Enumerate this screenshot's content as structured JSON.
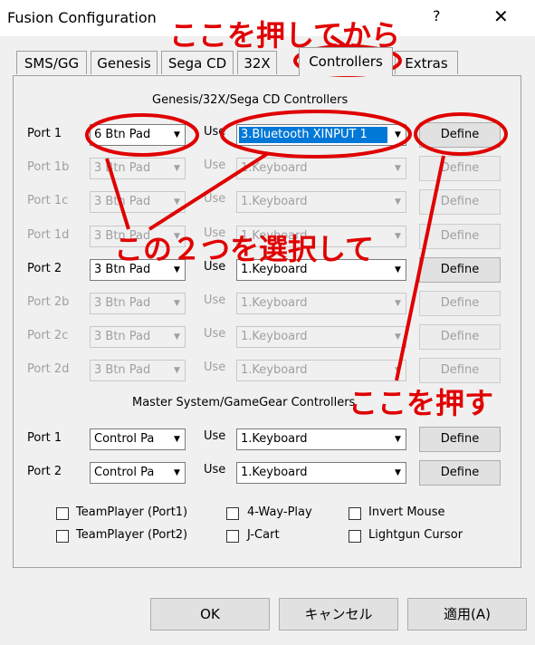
{
  "window": {
    "title": "Fusion Configuration",
    "help": "?",
    "close": "✕"
  },
  "tabs": [
    "SMS/GG",
    "Genesis",
    "Sega CD",
    "32X",
    "Controllers",
    "Extras"
  ],
  "active_tab": "Controllers",
  "genesis_section": {
    "title": "Genesis/32X/Sega CD Controllers",
    "use_label": "Use",
    "rows": [
      {
        "port": "Port 1",
        "pad": "6 Btn Pad",
        "use": "3.Bluetooth XINPUT 1",
        "define": "Define"
      },
      {
        "port": "Port 1b",
        "pad": "3 Btn Pad",
        "use": "1.Keyboard",
        "define": "Define"
      },
      {
        "port": "Port 1c",
        "pad": "3 Btn Pad",
        "use": "1.Keyboard",
        "define": "Define"
      },
      {
        "port": "Port 1d",
        "pad": "3 Btn Pad",
        "use": "1.Keyboard",
        "define": "Define"
      },
      {
        "port": "Port 2",
        "pad": "3 Btn Pad",
        "use": "1.Keyboard",
        "define": "Define"
      },
      {
        "port": "Port 2b",
        "pad": "3 Btn Pad",
        "use": "1.Keyboard",
        "define": "Define"
      },
      {
        "port": "Port 2c",
        "pad": "3 Btn Pad",
        "use": "1.Keyboard",
        "define": "Define"
      },
      {
        "port": "Port 2d",
        "pad": "3 Btn Pad",
        "use": "1.Keyboard",
        "define": "Define"
      }
    ]
  },
  "sms_section": {
    "title": "Master System/GameGear Controllers",
    "use_label": "Use",
    "rows": [
      {
        "port": "Port 1",
        "pad": "Control Pa",
        "use": "1.Keyboard",
        "define": "Define"
      },
      {
        "port": "Port 2",
        "pad": "Control Pa",
        "use": "1.Keyboard",
        "define": "Define"
      }
    ]
  },
  "checkboxes": [
    "TeamPlayer (Port1)",
    "4-Way-Play",
    "Invert Mouse",
    "TeamPlayer (Port2)",
    "J-Cart",
    "Lightgun Cursor"
  ],
  "buttons": {
    "ok": "OK",
    "cancel": "キャンセル",
    "apply": "適用(A)"
  },
  "annotations": {
    "a1": "ここを押してから",
    "a2": "この２つを選択して",
    "a3": "ここを押す",
    "color": "#e00000"
  }
}
